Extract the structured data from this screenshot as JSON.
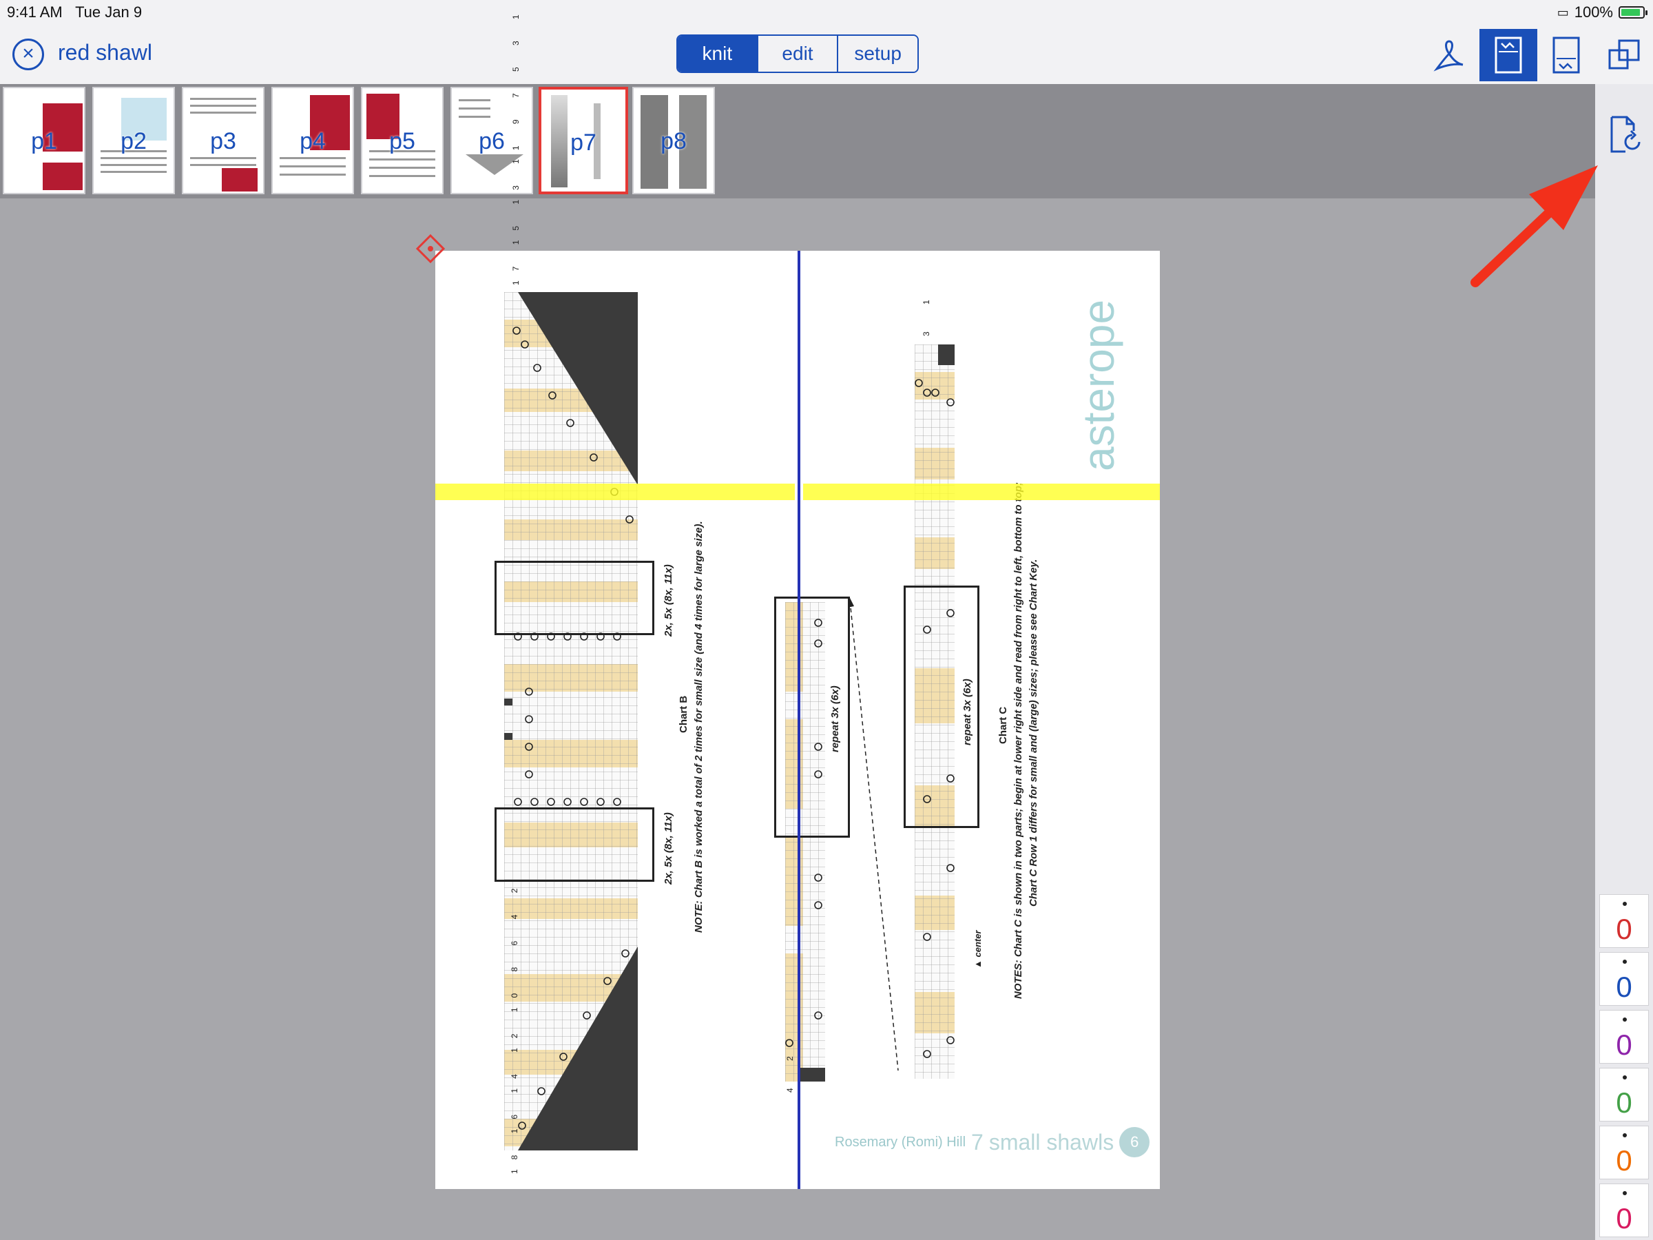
{
  "status": {
    "time": "9:41 AM",
    "date": "Tue Jan 9",
    "battery": "100%",
    "battery_level": 0.9
  },
  "nav": {
    "title": "red  shawl",
    "modes": [
      "knit",
      "edit",
      "setup"
    ],
    "active_mode": "knit"
  },
  "thumbnails": [
    "p1",
    "p2",
    "p3",
    "p4",
    "p5",
    "p6",
    "p7",
    "p8"
  ],
  "current_page": "p7",
  "pdf": {
    "brand_title": "asterope",
    "chart_b_title": "Chart B",
    "chart_b_note": "NOTE: Chart B is worked a total of 2 times for small size (and 4 times for large size).",
    "repeat_label_1": "2x, 5x (8x, 11x)",
    "repeat_label_2": "2x, 5x (8x, 11x)",
    "repeat_mid": "repeat 3x (6x)",
    "repeat_right": "repeat 3x (6x)",
    "chart_c_title": "Chart C",
    "chart_c_note_1": "NOTES: Chart C is shown in two parts; begin at lower right side and read from right to left, bottom to top;",
    "chart_c_note_2": "Chart C Row 1 differs for small and (large) sizes; please see Chart Key.",
    "center_label": "center",
    "author": "Rosemary (Romi) Hill",
    "book_number": "7",
    "book_name": "small shawls",
    "page_number": "6",
    "row_numbers_top": [
      "17",
      "15",
      "13",
      "11",
      "9",
      "7",
      "5",
      "3",
      "1"
    ],
    "row_numbers_bottom": [
      "18",
      "16",
      "14",
      "12",
      "10",
      "8",
      "6",
      "4",
      "2"
    ],
    "mid_top_numbers": [
      "3",
      "1"
    ],
    "mid_bottom_numbers": [
      "4",
      "2"
    ]
  },
  "counters": [
    {
      "value": "0",
      "color": "#d32f2f"
    },
    {
      "value": "0",
      "color": "#1a4fb8"
    },
    {
      "value": "0",
      "color": "#8e24aa"
    },
    {
      "value": "0",
      "color": "#43a047"
    },
    {
      "value": "0",
      "color": "#ef6c00"
    },
    {
      "value": "0",
      "color": "#d81b60"
    }
  ],
  "colors": {
    "accent": "#1a4fb8",
    "highlight": "#ffff28",
    "chart_tan": "#f3dfae",
    "chart_dark": "#3b3b3b",
    "annotation_arrow": "#f2301b"
  },
  "icons": [
    "close-icon",
    "pdf-tool-icon",
    "chart-view-icon",
    "chart-view-alt-icon",
    "window-copy-icon",
    "rotate-page-icon",
    "place-marker-icon"
  ]
}
